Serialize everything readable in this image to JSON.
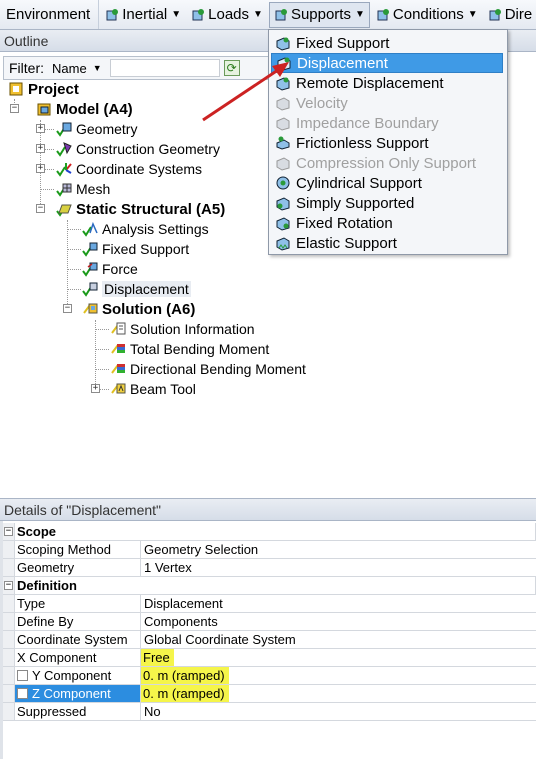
{
  "toolbar": {
    "environment": "Environment",
    "items": [
      {
        "label": "Inertial",
        "icon": "inertial-icon"
      },
      {
        "label": "Loads",
        "icon": "loads-icon"
      },
      {
        "label": "Supports",
        "icon": "supports-icon"
      },
      {
        "label": "Conditions",
        "icon": "conditions-icon"
      },
      {
        "label": "Dire",
        "icon": "direct-fe-icon"
      }
    ]
  },
  "outline": {
    "header": "Outline",
    "filter_label": "Filter:",
    "filter_value": "Name",
    "tree": [
      {
        "label": "Project"
      },
      {
        "label": "Model (A4)"
      },
      {
        "label": "Geometry"
      },
      {
        "label": "Construction Geometry"
      },
      {
        "label": "Coordinate Systems"
      },
      {
        "label": "Mesh"
      },
      {
        "label": "Static Structural (A5)"
      },
      {
        "label": "Analysis Settings"
      },
      {
        "label": "Fixed Support"
      },
      {
        "label": "Force"
      },
      {
        "label": "Displacement"
      },
      {
        "label": "Solution (A6)"
      },
      {
        "label": "Solution Information"
      },
      {
        "label": "Total Bending Moment"
      },
      {
        "label": "Directional Bending Moment"
      },
      {
        "label": "Beam Tool"
      }
    ]
  },
  "supports_menu": {
    "items": [
      {
        "label": "Fixed Support",
        "state": "normal"
      },
      {
        "label": "Displacement",
        "state": "highlighted"
      },
      {
        "label": "Remote Displacement",
        "state": "normal"
      },
      {
        "label": "Velocity",
        "state": "disabled"
      },
      {
        "label": "Impedance Boundary",
        "state": "disabled"
      },
      {
        "label": "Frictionless Support",
        "state": "normal"
      },
      {
        "label": "Compression Only Support",
        "state": "disabled"
      },
      {
        "label": "Cylindrical Support",
        "state": "normal"
      },
      {
        "label": "Simply Supported",
        "state": "normal"
      },
      {
        "label": "Fixed Rotation",
        "state": "normal"
      },
      {
        "label": "Elastic Support",
        "state": "normal"
      }
    ]
  },
  "details": {
    "header": "Details of \"Displacement\"",
    "scope": {
      "title": "Scope",
      "rows": [
        {
          "name": "Scoping Method",
          "value": "Geometry Selection"
        },
        {
          "name": "Geometry",
          "value": "1 Vertex"
        }
      ]
    },
    "definition": {
      "title": "Definition",
      "rows": [
        {
          "name": "Type",
          "value": "Displacement"
        },
        {
          "name": "Define By",
          "value": "Components"
        },
        {
          "name": "Coordinate System",
          "value": "Global Coordinate System"
        },
        {
          "name": "X Component",
          "value": "Free"
        },
        {
          "name": "Y Component",
          "value": "0. m  (ramped)"
        },
        {
          "name": "Z Component",
          "value": "0. m  (ramped)"
        },
        {
          "name": "Suppressed",
          "value": "No"
        }
      ]
    }
  },
  "colors": {
    "menu_highlight": "#3f9ae6",
    "annotation_arrow": "#cc2222",
    "value_highlight": "#f5f54a"
  }
}
